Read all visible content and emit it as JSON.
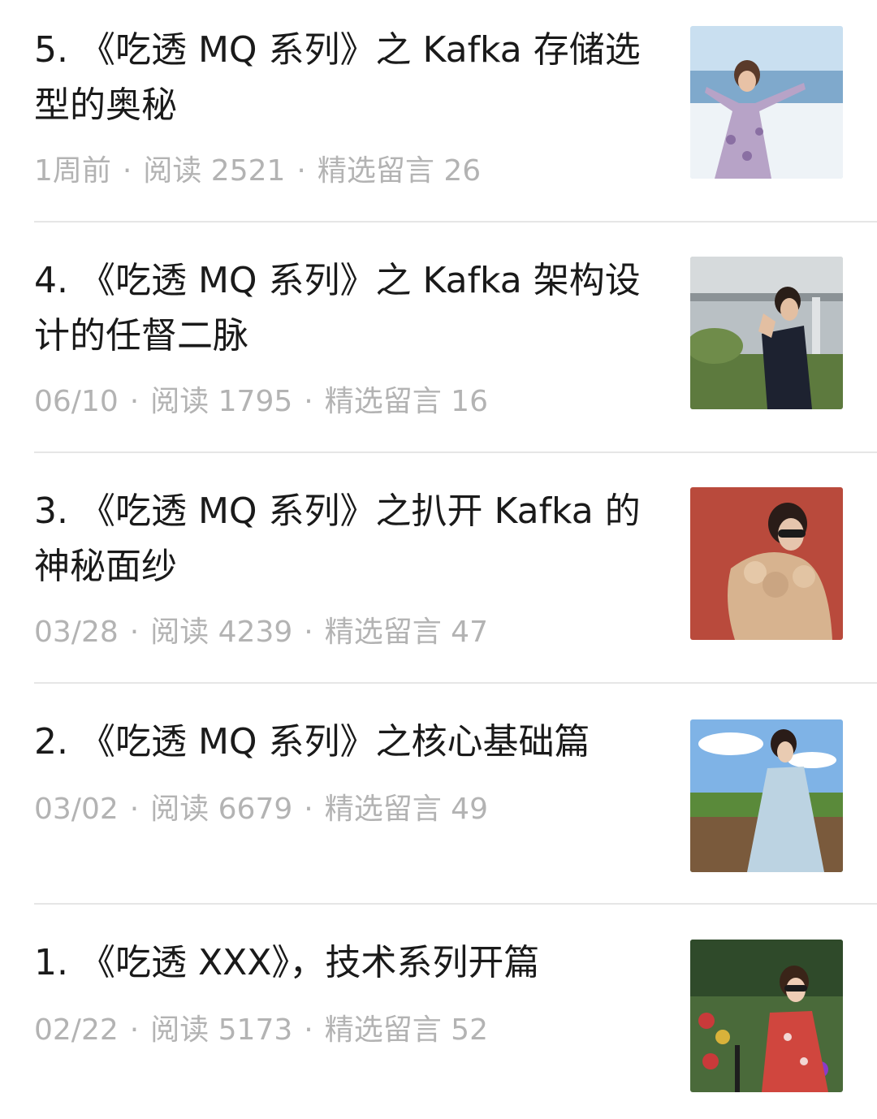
{
  "articles": [
    {
      "title": "5. 《吃透 MQ 系列》之 Kafka 存储选型的奥秘",
      "date": "1周前",
      "reads": "阅读 2521",
      "comments": "精选留言 26",
      "thumb_icon": "photo-woman-beach"
    },
    {
      "title": "4. 《吃透 MQ 系列》之 Kafka 架构设计的任督二脉",
      "date": "06/10",
      "reads": "阅读 1795",
      "comments": "精选留言 16",
      "thumb_icon": "photo-woman-building"
    },
    {
      "title": "3. 《吃透 MQ 系列》之扒开 Kafka 的神秘面纱",
      "date": "03/28",
      "reads": "阅读 4239",
      "comments": "精选留言 47",
      "thumb_icon": "photo-woman-fur-coat"
    },
    {
      "title": "2. 《吃透 MQ 系列》之核心基础篇",
      "date": "03/02",
      "reads": "阅读 6679",
      "comments": "精选留言 49",
      "thumb_icon": "photo-woman-field"
    },
    {
      "title": "1. 《吃透 XXX》，技术系列开篇",
      "date": "02/22",
      "reads": "阅读 5173",
      "comments": "精选留言 52",
      "thumb_icon": "photo-woman-garden"
    }
  ],
  "colors": {
    "title": "#1a1a1a",
    "meta": "#b3b3b3",
    "divider": "#e6e6e6"
  }
}
